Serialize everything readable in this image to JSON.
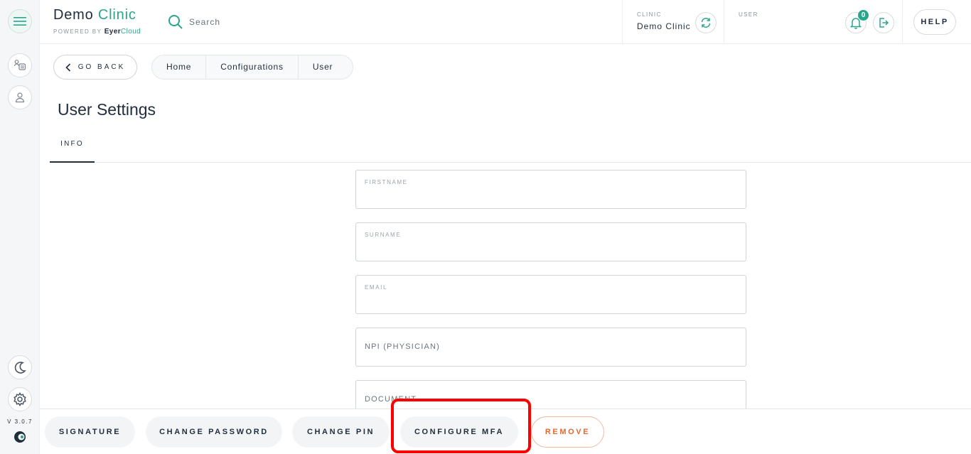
{
  "app": {
    "title_main": "Demo",
    "title_accent": "Clinic",
    "powered_by": "POWERED BY",
    "brand_eyer": "Eyer",
    "brand_cloud": "Cloud",
    "version": "V 3.0.7"
  },
  "search": {
    "placeholder": "Search"
  },
  "header": {
    "clinic_label": "CLINIC",
    "clinic_name": "Demo Clinic",
    "user_label": "USER",
    "notification_count": "0",
    "help_label": "HELP"
  },
  "nav": {
    "back_label": "GO BACK",
    "breadcrumbs": [
      "Home",
      "Configurations",
      "User"
    ]
  },
  "page": {
    "title": "User Settings",
    "tabs": [
      "INFO"
    ]
  },
  "form": {
    "firstname_label": "FIRSTNAME",
    "firstname_value": "",
    "surname_label": "SURNAME",
    "surname_value": "",
    "email_label": "EMAIL",
    "email_value": "",
    "npi_placeholder": "NPI (PHYSICIAN)",
    "document_placeholder": "DOCUMENT"
  },
  "actions": {
    "signature": "SIGNATURE",
    "change_password": "CHANGE PASSWORD",
    "change_pin": "CHANGE PIN",
    "configure_mfa": "CONFIGURE MFA",
    "remove": "REMOVE"
  },
  "colors": {
    "accent": "#2aa58c",
    "text": "#1f2d3d",
    "danger": "#e06a32",
    "highlight": "#ff0000"
  },
  "icons": [
    "menu-icon",
    "patients-list-icon",
    "user-icon",
    "moon-icon",
    "gear-icon",
    "search-icon",
    "sync-icon",
    "bell-icon",
    "logout-icon",
    "chevron-left-icon"
  ]
}
